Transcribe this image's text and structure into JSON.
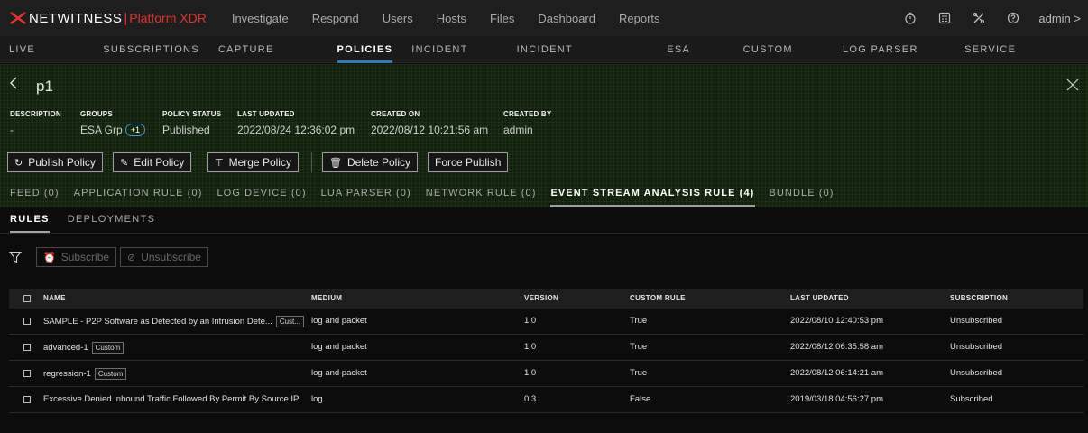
{
  "brand": {
    "name": "NETWITNESS",
    "separator": "|",
    "product": "Platform XDR"
  },
  "top_nav": [
    "Investigate",
    "Respond",
    "Users",
    "Hosts",
    "Files",
    "Dashboard",
    "Reports"
  ],
  "user": {
    "name": "admin",
    "chevron": ">"
  },
  "top_icons": [
    "timer-icon",
    "calculator-icon",
    "tools-icon",
    "help-icon"
  ],
  "sub_nav": [
    {
      "label": "LIVE CONTENT",
      "active": false
    },
    {
      "label": "SUBSCRIPTIONS",
      "active": false
    },
    {
      "label": "CAPTURE POLICIES",
      "active": false
    },
    {
      "label": "POLICIES",
      "active": true
    },
    {
      "label": "INCIDENT RULES",
      "active": false
    },
    {
      "label": "INCIDENT NOTIFICATIONS",
      "active": false
    },
    {
      "label": "ESA RULES",
      "active": false
    },
    {
      "label": "CUSTOM FEEDS",
      "active": false
    },
    {
      "label": "LOG PARSER RULES",
      "active": false
    },
    {
      "label": "SERVICE TOPOLOGY",
      "active": false
    }
  ],
  "policy": {
    "title": "p1",
    "meta": {
      "description": {
        "label": "DESCRIPTION",
        "value": "-"
      },
      "groups": {
        "label": "GROUPS",
        "value": "ESA Grp",
        "extra": "+1"
      },
      "status": {
        "label": "POLICY STATUS",
        "value": "Published"
      },
      "last_updated": {
        "label": "LAST UPDATED",
        "value": "2022/08/24 12:36:02 pm"
      },
      "created_on": {
        "label": "CREATED ON",
        "value": "2022/08/12 10:21:56 am"
      },
      "created_by": {
        "label": "CREATED BY",
        "value": "admin"
      }
    },
    "actions": {
      "publish": "Publish Policy",
      "edit": "Edit Policy",
      "merge": "Merge Policy",
      "delete": "Delete Policy",
      "force_publish": "Force Publish"
    },
    "content_tabs": [
      {
        "label": "FEED (0)",
        "active": false
      },
      {
        "label": "APPLICATION RULE (0)",
        "active": false
      },
      {
        "label": "LOG DEVICE (0)",
        "active": false
      },
      {
        "label": "LUA PARSER (0)",
        "active": false
      },
      {
        "label": "NETWORK RULE (0)",
        "active": false
      },
      {
        "label": "EVENT STREAM ANALYSIS RULE (4)",
        "active": true
      },
      {
        "label": "BUNDLE (0)",
        "active": false
      }
    ]
  },
  "inner_tabs": [
    {
      "label": "RULES",
      "active": true
    },
    {
      "label": "DEPLOYMENTS",
      "active": false
    }
  ],
  "toolbar": {
    "subscribe": "Subscribe",
    "unsubscribe": "Unsubscribe",
    "subscribe_enabled": false,
    "unsubscribe_enabled": false
  },
  "table": {
    "columns": [
      "NAME",
      "MEDIUM",
      "VERSION",
      "CUSTOM RULE",
      "LAST UPDATED",
      "SUBSCRIPTION"
    ],
    "rows": [
      {
        "name": "SAMPLE - P2P Software as Detected by an Intrusion Dete...",
        "tag": "Cust...",
        "medium": "log and packet",
        "version": "1.0",
        "custom": "True",
        "updated": "2022/08/10 12:40:53 pm",
        "subscription": "Unsubscribed"
      },
      {
        "name": "advanced-1",
        "tag": "Custom",
        "medium": "log and packet",
        "version": "1.0",
        "custom": "True",
        "updated": "2022/08/12 06:35:58 am",
        "subscription": "Unsubscribed"
      },
      {
        "name": "regression-1",
        "tag": "Custom",
        "medium": "log and packet",
        "version": "1.0",
        "custom": "True",
        "updated": "2022/08/12 06:14:21 am",
        "subscription": "Unsubscribed"
      },
      {
        "name": "Excessive Denied Inbound Traffic Followed By Permit By Source IP",
        "tag": "",
        "medium": "log",
        "version": "0.3",
        "custom": "False",
        "updated": "2019/03/18 04:56:27 pm",
        "subscription": "Subscribed"
      }
    ]
  },
  "colors": {
    "brand_accent": "#e0322f",
    "active_tab": "#2f7bbf",
    "header_bg": "#13200f",
    "badge": "#3d8fd8"
  }
}
